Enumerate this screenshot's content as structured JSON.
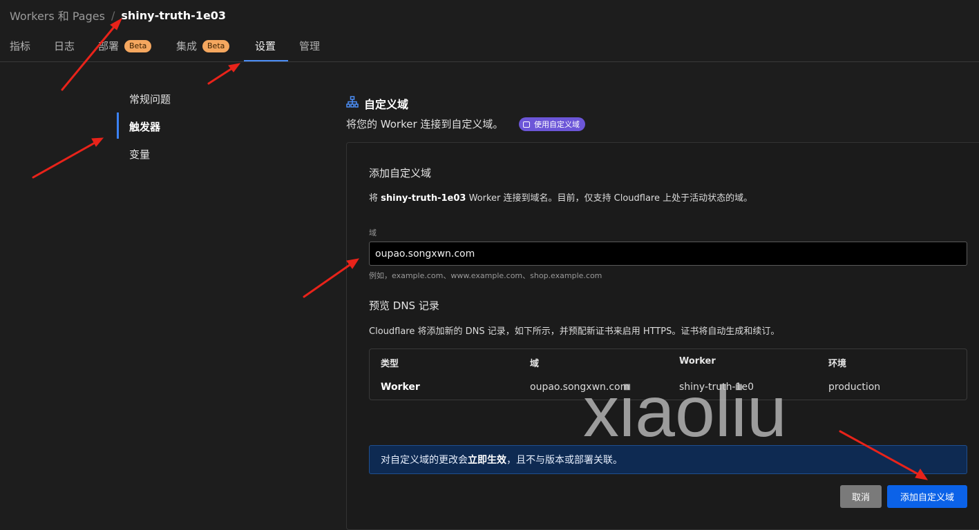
{
  "breadcrumb": {
    "parent": "Workers 和 Pages",
    "separator": "/",
    "current": "shiny-truth-1e03"
  },
  "tabs": [
    {
      "label": "指标"
    },
    {
      "label": "日志"
    },
    {
      "label": "部署",
      "badge": "Beta"
    },
    {
      "label": "集成",
      "badge": "Beta"
    },
    {
      "label": "设置",
      "active": true
    },
    {
      "label": "管理"
    }
  ],
  "sidebar": {
    "items": [
      {
        "label": "常规问题"
      },
      {
        "label": "触发器",
        "active": true
      },
      {
        "label": "变量"
      }
    ]
  },
  "section": {
    "icon": "sitemap-icon",
    "title": "自定义域",
    "description": "将您的 Worker 连接到自定义域。",
    "pill_label": "使用自定义域"
  },
  "form": {
    "title": "添加自定义域",
    "desc_prefix": "将",
    "desc_worker": "shiny-truth-1e03",
    "desc_suffix": "Worker 连接到域名。目前，仅支持 Cloudflare 上处于活动状态的域。",
    "field_label": "域",
    "field_value": "oupao.songxwn.com",
    "field_hint": "例如，example.com、www.example.com、shop.example.com"
  },
  "preview": {
    "title": "预览 DNS 记录",
    "description": "Cloudflare 将添加新的 DNS 记录，如下所示，并预配新证书来启用 HTTPS。证书将自动生成和续订。",
    "columns": [
      "类型",
      "域",
      "Worker",
      "环境"
    ],
    "row": [
      "Worker",
      "oupao.songxwn.com",
      "shiny-truth-1e0",
      "production"
    ]
  },
  "notice": {
    "prefix": "对自定义域的更改会",
    "bold": "立即生效",
    "suffix": "，且不与版本或部署关联。"
  },
  "buttons": {
    "cancel": "取消",
    "add": "添加自定义域"
  },
  "watermark": "xiaoliu",
  "colors": {
    "accent": "#3b82f6",
    "primary_button": "#0b62e8",
    "badge": "#f5a75f",
    "pill": "#6c56d8",
    "annotation_arrow": "#e8231a"
  }
}
